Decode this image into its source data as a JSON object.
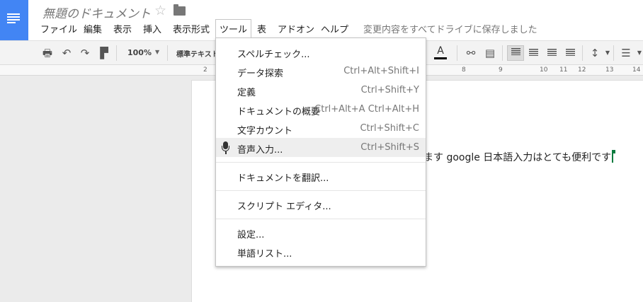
{
  "document": {
    "title": "無題のドキュメント",
    "save_status": "変更内容をすべてドライブに保存しました"
  },
  "menubar": {
    "file": "ファイル",
    "edit": "編集",
    "view": "表示",
    "insert": "挿入",
    "format": "表示形式",
    "tools": "ツール",
    "table": "表",
    "addons": "アドオン",
    "help": "ヘルプ"
  },
  "toolbar": {
    "zoom": "100%",
    "style": "標準テキスト",
    "text_color_label": "A"
  },
  "ruler": {
    "ticks": [
      "2",
      "8",
      "9",
      "10",
      "11",
      "12",
      "13",
      "14"
    ]
  },
  "tools_menu": {
    "items": [
      {
        "label": "スペルチェック...",
        "shortcut": ""
      },
      {
        "label": "データ探索",
        "shortcut": "Ctrl+Alt+Shift+I"
      },
      {
        "label": "定義",
        "shortcut": "Ctrl+Shift+Y"
      },
      {
        "label": "ドキュメントの概要",
        "shortcut": "Ctrl+Alt+A Ctrl+Alt+H"
      },
      {
        "label": "文字カウント",
        "shortcut": "Ctrl+Shift+C"
      },
      {
        "label": "音声入力...",
        "shortcut": "Ctrl+Shift+S"
      },
      {
        "label": "ドキュメントを翻訳...",
        "shortcut": ""
      },
      {
        "label": "スクリプト エディタ...",
        "shortcut": ""
      },
      {
        "label": "設定...",
        "shortcut": ""
      },
      {
        "label": "単語リスト...",
        "shortcut": ""
      }
    ]
  },
  "page": {
    "body_text": "ます google 日本語入力はとても便利です"
  },
  "colors": {
    "brand_blue": "#4285f4",
    "cursor_green": "#0b7b3e"
  }
}
